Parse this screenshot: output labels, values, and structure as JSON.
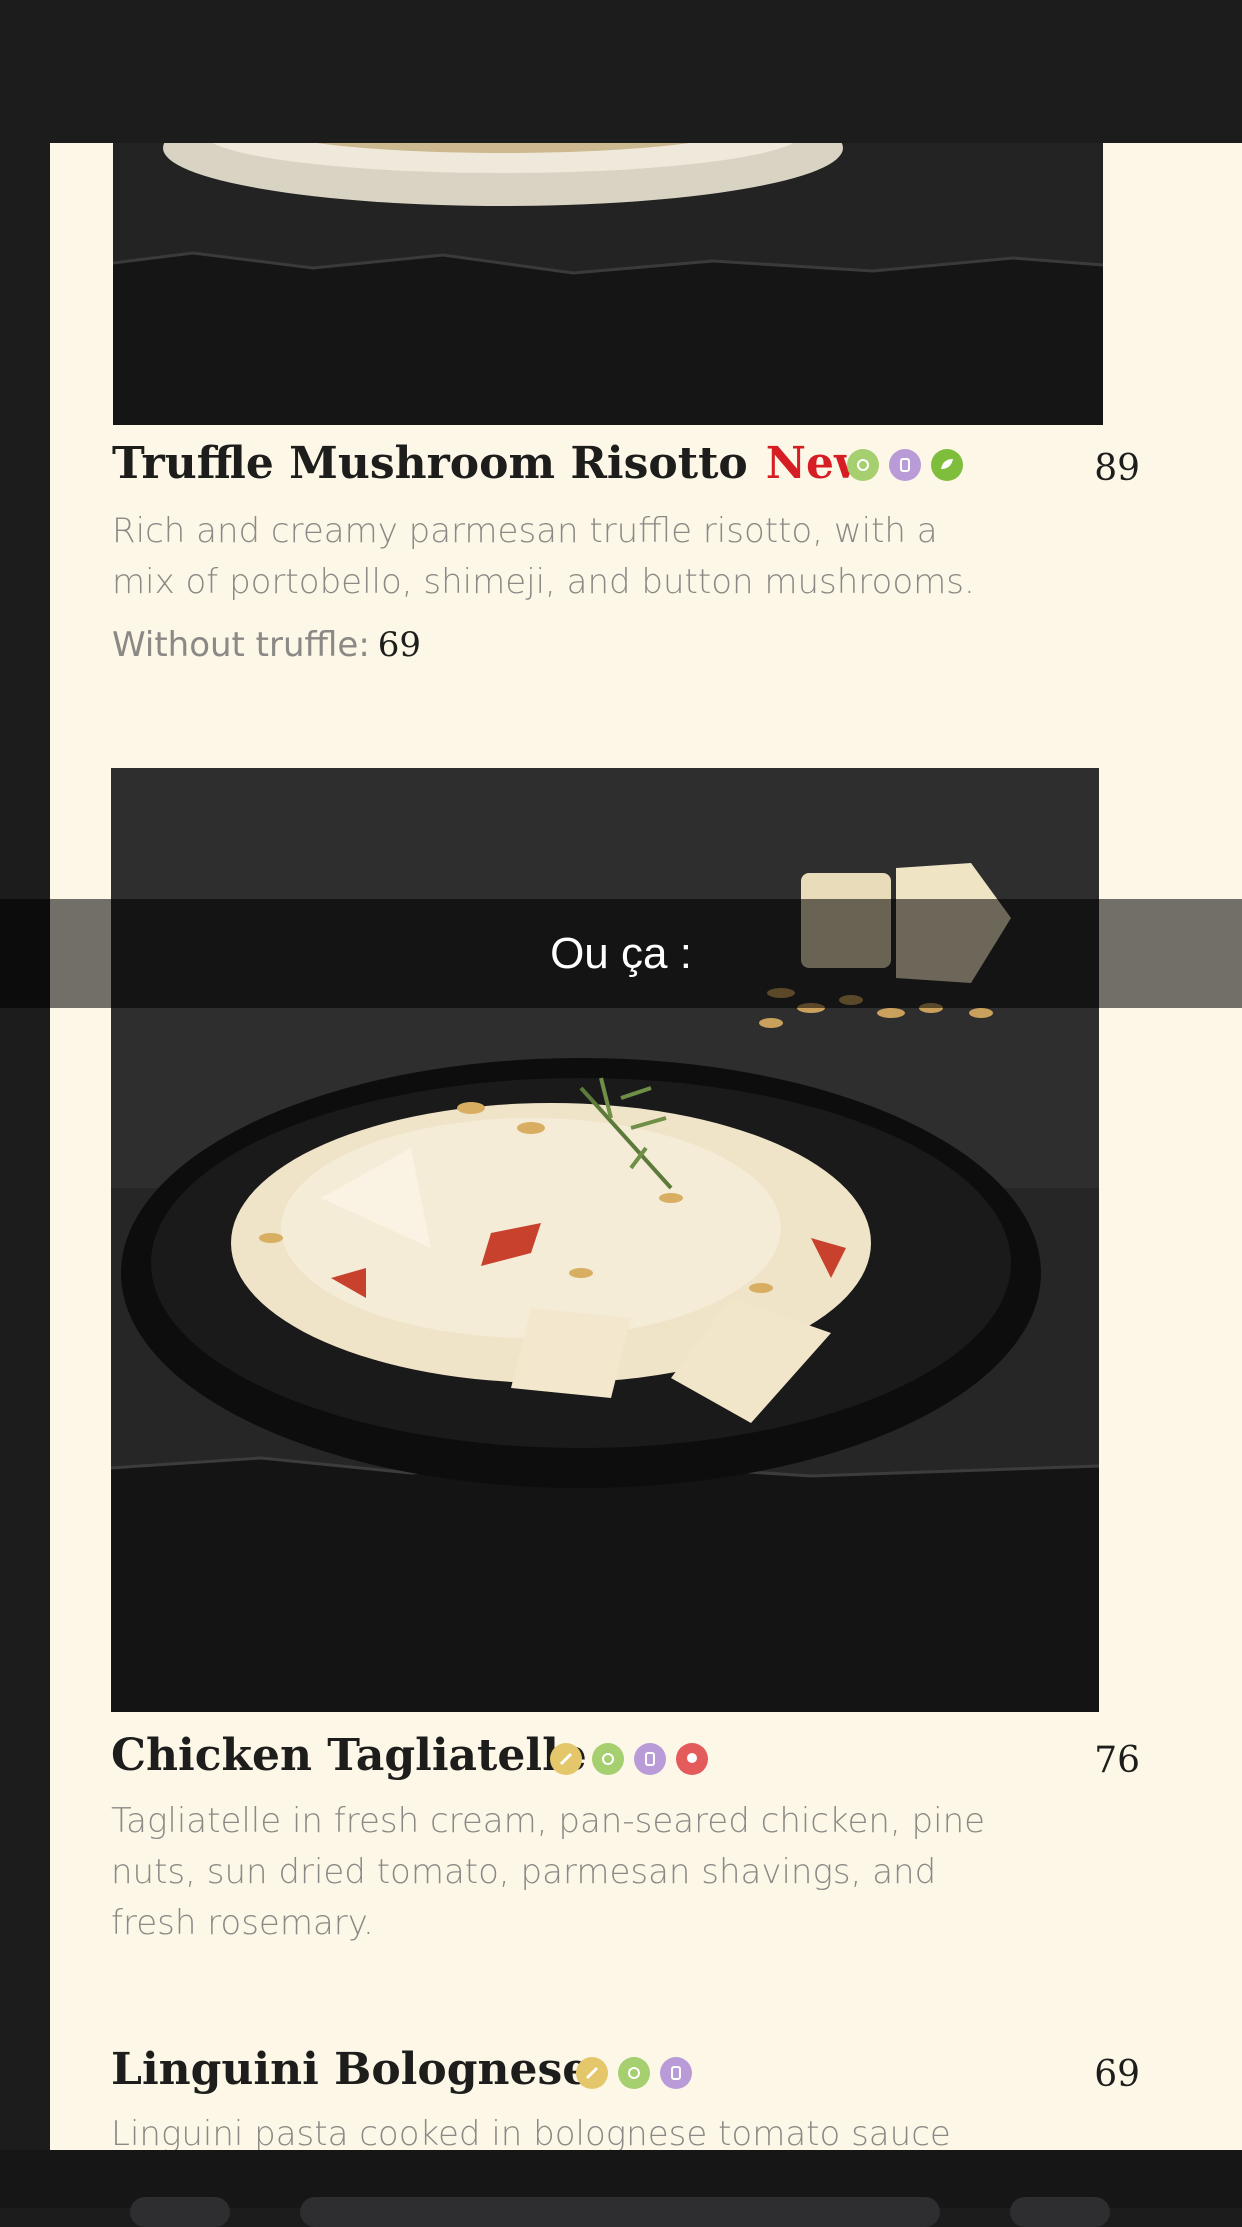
{
  "dishes": [
    {
      "name": "Truffle Mushroom Risotto",
      "badge": "New",
      "price": "89",
      "description_lines": [
        "Rich and creamy parmesan truffle risotto, with a",
        "mix of portobello, shimeji, and button mushrooms."
      ],
      "extra_label": "Without truffle:",
      "extra_price": "69",
      "icons": [
        {
          "name": "gluten-icon",
          "color": "#a6cf6f"
        },
        {
          "name": "dairy-icon",
          "color": "#b99bd8"
        },
        {
          "name": "vegetarian-icon",
          "color": "#7fbe3c"
        }
      ]
    },
    {
      "name": "Chicken Tagliatelle",
      "price": "76",
      "description_lines": [
        "Tagliatelle in fresh cream, pan-seared chicken, pine",
        "nuts, sun dried tomato, parmesan shavings, and",
        "fresh rosemary."
      ],
      "icons": [
        {
          "name": "nuts-icon",
          "color": "#e5c76b"
        },
        {
          "name": "gluten-icon",
          "color": "#a6cf6f"
        },
        {
          "name": "dairy-icon",
          "color": "#b99bd8"
        },
        {
          "name": "chicken-icon",
          "color": "#e35b5b"
        }
      ]
    },
    {
      "name": "Linguini Bolognese",
      "price": "69",
      "description_lines": [
        "Linguini pasta cooked in bolognese tomato sauce"
      ],
      "icons": [
        {
          "name": "nuts-icon",
          "color": "#e5c76b"
        },
        {
          "name": "gluten-icon",
          "color": "#a6cf6f"
        },
        {
          "name": "dairy-icon",
          "color": "#b99bd8"
        }
      ]
    }
  ],
  "caption": "Ou ça :"
}
